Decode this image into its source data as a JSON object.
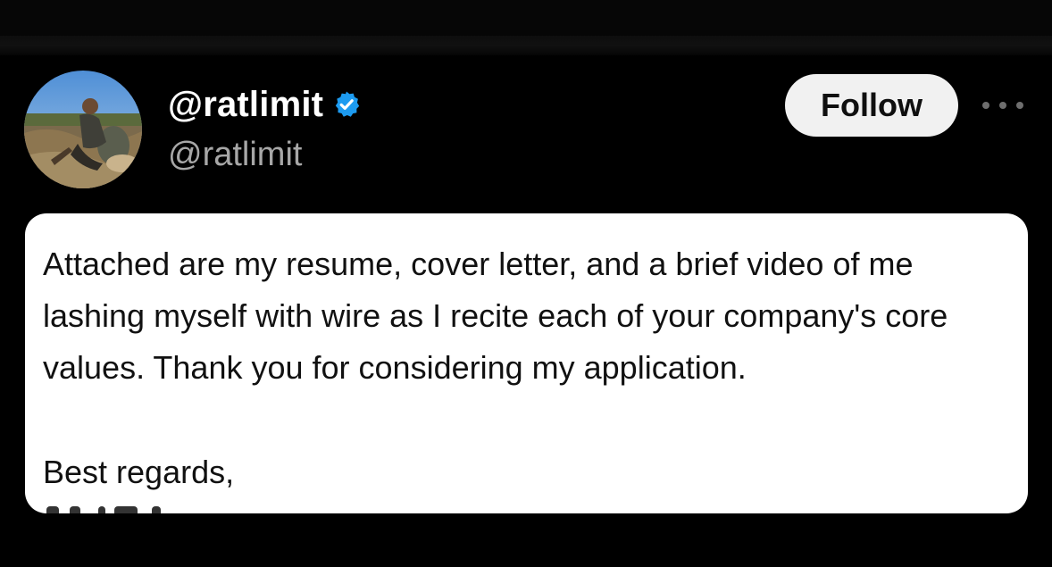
{
  "author": {
    "display_name": "@ratlimit",
    "handle": "@ratlimit",
    "verified": true,
    "avatar_icon": "profile-photo"
  },
  "actions": {
    "follow_label": "Follow",
    "more_icon": "more-horizontal-icon"
  },
  "tweet": {
    "body": "Attached are my resume, cover letter, and a brief video of me lashing myself with wire as I recite each of your company's core values. Thank you for considering my application.",
    "signoff": "Best regards,"
  },
  "colors": {
    "background": "#000000",
    "verified_badge": "#1d9bf0",
    "card": "#ffffff",
    "follow_button": "#f1f1f1"
  }
}
